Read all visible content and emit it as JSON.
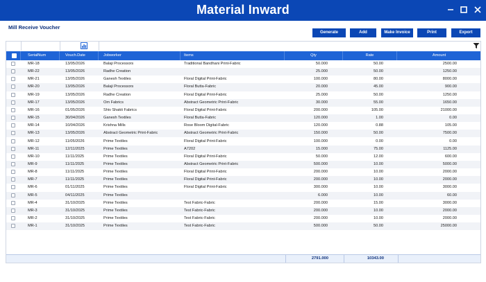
{
  "window": {
    "title": "Material Inward",
    "controls": [
      "minimize-icon",
      "maximize-icon",
      "close-icon"
    ]
  },
  "page": {
    "subtitle": "Mill Receive Voucher"
  },
  "toolbar": {
    "buttons": [
      "Generate",
      "Add",
      "Make Invoice",
      "Print",
      "Export"
    ]
  },
  "table": {
    "columns": [
      "SerialNum",
      "Vouch.Date",
      "Jobworker",
      "Items",
      "Qty",
      "Rate",
      "Amount"
    ],
    "rows": [
      [
        "MR-18",
        "13/05/2026",
        "Balaji Processors",
        "Traditional Bandhani Print-Fabric",
        "50.000",
        "50.00",
        "2500.00"
      ],
      [
        "MR-22",
        "13/05/2026",
        "Radhe Creation",
        "",
        "25.000",
        "50.00",
        "1250.00"
      ],
      [
        "MR-21",
        "13/05/2026",
        "Ganesh Textiles",
        "Floral Digital Print-Fabric",
        "100.000",
        "80.00",
        "8000.00"
      ],
      [
        "MR-20",
        "13/05/2026",
        "Balaji Processors",
        "Floral Butta-Fabric",
        "20.000",
        "45.00",
        "900.00"
      ],
      [
        "MR-19",
        "13/05/2026",
        "Radhe Creation",
        "Floral Digital Print-Fabric",
        "25.000",
        "50.00",
        "1250.00"
      ],
      [
        "MR-17",
        "13/05/2026",
        "Om Fabrics",
        "Abstract Geometric Print-Fabric",
        "30.000",
        "55.00",
        "1650.00"
      ],
      [
        "MR-16",
        "01/05/2026",
        "Shiv Shakti Fabrics",
        "Floral Digital Print-Fabric",
        "200.000",
        "105.00",
        "21000.00"
      ],
      [
        "MR-15",
        "30/04/2026",
        "Ganesh Textiles",
        "Floral Butta-Fabric",
        "120.000",
        "1.00",
        "0.00"
      ],
      [
        "MR-14",
        "10/04/2026",
        "Krishna Mills",
        "Rose Bloom Digital-Fabric",
        "120.000",
        "0.88",
        "105.00"
      ],
      [
        "MR-13",
        "13/05/2026",
        "Abstract Geometric Print-Fabric",
        "Abstract Geometric Print-Fabric",
        "150.000",
        "50.00",
        "7500.00"
      ],
      [
        "MR-12",
        "11/05/2026",
        "Prime Textiles",
        "Floral Digital Print-Fabric",
        "100.000",
        "0.00",
        "0.00"
      ],
      [
        "MR-11",
        "12/11/2025",
        "Prime Textiles",
        "A7202",
        "15.000",
        "75.00",
        "1125.00"
      ],
      [
        "MR-10",
        "11/11/2025",
        "Prime Textiles",
        "Floral Digital Print-Fabric",
        "50.000",
        "12.00",
        "600.00"
      ],
      [
        "MR-9",
        "11/11/2025",
        "Prime Textiles",
        "Abstract Geometric Print-Fabric",
        "500.000",
        "10.00",
        "5000.00"
      ],
      [
        "MR-8",
        "11/11/2025",
        "Prime Textiles",
        "Floral Digital Print-Fabric",
        "200.000",
        "10.00",
        "2000.00"
      ],
      [
        "MR-7",
        "11/11/2025",
        "Prime Textiles",
        "Floral Digital Print-Fabric",
        "200.000",
        "10.00",
        "2000.00"
      ],
      [
        "MR-6",
        "01/11/2025",
        "Prime Textiles",
        "Floral Digital Print-Fabric",
        "300.000",
        "10.00",
        "3000.00"
      ],
      [
        "MR-5",
        "04/11/2025",
        "Prime Textiles",
        "",
        "6.000",
        "10.00",
        "60.00"
      ],
      [
        "MR-4",
        "31/10/2025",
        "Prime Textiles",
        "Test Fabric-Fabric",
        "200.000",
        "15.00",
        "3000.00"
      ],
      [
        "MR-3",
        "31/10/2025",
        "Prime Textiles",
        "Test Fabric-Fabric",
        "200.000",
        "10.00",
        "2000.00"
      ],
      [
        "MR-2",
        "31/10/2025",
        "Prime Textiles",
        "Test Fabric-Fabric",
        "200.000",
        "10.00",
        "2000.00"
      ],
      [
        "MR-1",
        "31/10/2025",
        "Prime Textiles",
        "Test Fabric-Fabric",
        "500.000",
        "50.00",
        "25000.00"
      ]
    ],
    "totals": {
      "qty": "2791.000",
      "rate": "10343.00"
    }
  },
  "colors": {
    "primary": "#0b47b5",
    "header": "#1f64d6"
  },
  "icons": {
    "column_chooser": "chart-icon",
    "filter": "filter-icon"
  }
}
